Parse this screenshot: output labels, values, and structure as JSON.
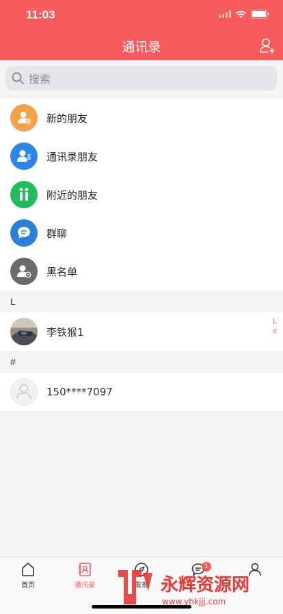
{
  "status_bar": {
    "time": "11:03"
  },
  "nav": {
    "title": "通讯录"
  },
  "search": {
    "placeholder": "搜索"
  },
  "menu": [
    {
      "label": "新的朋友",
      "icon": "new-friend-icon",
      "color": "#f5a04a"
    },
    {
      "label": "通讯录朋友",
      "icon": "address-book-friend-icon",
      "color": "#2c86e8"
    },
    {
      "label": "附近的朋友",
      "icon": "nearby-friends-icon",
      "color": "#1ebe5b"
    },
    {
      "label": "群聊",
      "icon": "group-chat-icon",
      "color": "#2c7fd6"
    },
    {
      "label": "黑名单",
      "icon": "blacklist-icon",
      "color": "#6b6b6b"
    }
  ],
  "sections": [
    {
      "header": "L",
      "contacts": [
        {
          "name": "李铁猴1"
        }
      ]
    },
    {
      "header": "#",
      "contacts": [
        {
          "name": "150****7097"
        }
      ]
    }
  ],
  "index": [
    "L",
    "#"
  ],
  "tabs": [
    {
      "label": "首页",
      "icon": "home-icon"
    },
    {
      "label": "通讯录",
      "icon": "contacts-icon",
      "active": true
    },
    {
      "label": "发现",
      "icon": "discover-icon"
    },
    {
      "label": "",
      "icon": "messages-icon",
      "badge": "1"
    },
    {
      "label": "",
      "icon": "profile-icon"
    }
  ],
  "watermark": {
    "text": "永辉资源网",
    "url": "www.yhkjjj.com"
  },
  "colors": {
    "accent": "#f75a5a"
  }
}
